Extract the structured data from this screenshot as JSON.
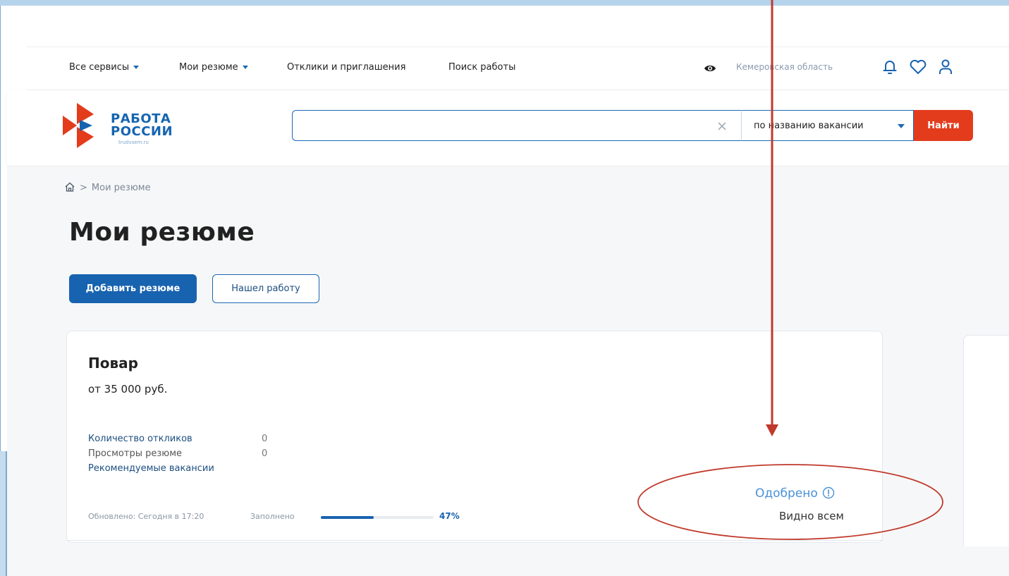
{
  "topnav": {
    "all_services": "Все сервисы",
    "my_resumes": "Мои резюме",
    "responses": "Отклики и приглашения",
    "job_search": "Поиск работы",
    "region": "Кемеровская область"
  },
  "header": {
    "logo_line1": "РАБОТА",
    "logo_line2": "РОССИИ",
    "logo_domain": "trudvsem.ru",
    "search_value": "",
    "search_mode": "по названию вакансии",
    "find_label": "Найти"
  },
  "breadcrumb": {
    "current": "Мои резюме",
    "separator": ">"
  },
  "page": {
    "title": "Мои резюме",
    "add_resume_label": "Добавить резюме",
    "found_job_label": "Нашел работу"
  },
  "resume": {
    "title": "Повар",
    "salary": "от 35 000 руб.",
    "responses_label": "Количество откликов",
    "responses_count": "0",
    "views_label": "Просмотры резюме",
    "views_count": "0",
    "recommended_label": "Рекомендуемые вакансии",
    "updated": "Обновлено: Сегодня в 17:20",
    "filled_label": "Заполнено",
    "filled_percent": 47,
    "filled_text": "47%",
    "status": "Одобрено",
    "visibility": "Видно всем"
  },
  "colors": {
    "brand_blue": "#1863b0",
    "brand_red": "#e33c1d",
    "status_blue": "#4a90d9",
    "annotation_red": "#c0392b"
  },
  "icons": [
    "eye-icon",
    "bell-icon",
    "heart-icon",
    "user-icon",
    "clear-icon",
    "home-icon",
    "info-icon"
  ]
}
